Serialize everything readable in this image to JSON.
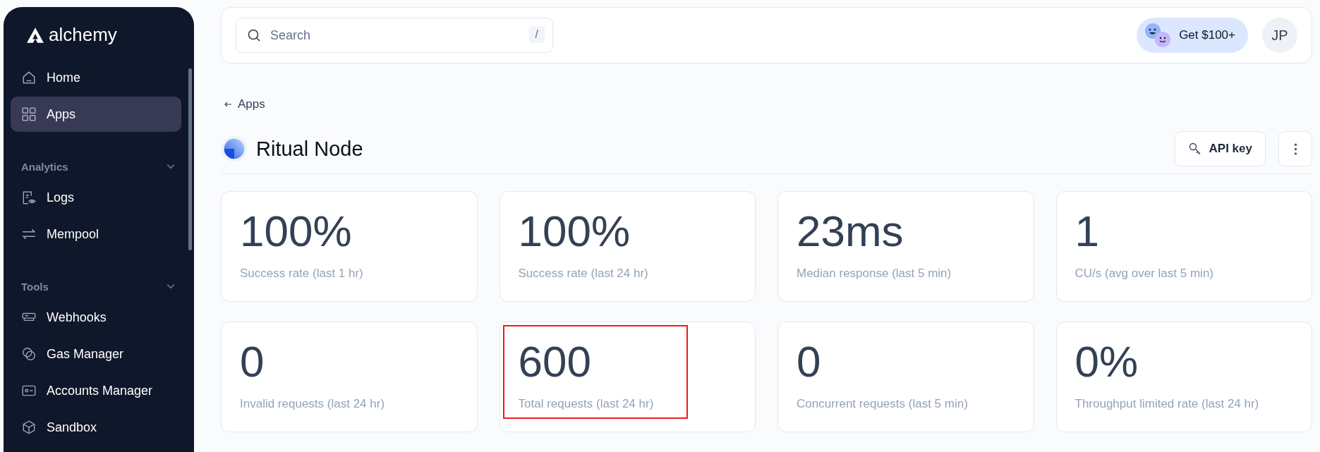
{
  "sidebar": {
    "logo": "alchemy",
    "items": [
      {
        "label": "Home",
        "selected": false
      },
      {
        "label": "Apps",
        "selected": true
      }
    ],
    "sections": [
      {
        "title": "Analytics",
        "expanded": true,
        "items": [
          {
            "label": "Logs",
            "selected": false
          },
          {
            "label": "Mempool",
            "selected": false
          }
        ]
      },
      {
        "title": "Tools",
        "expanded": true,
        "items": [
          {
            "label": "Webhooks",
            "selected": false
          },
          {
            "label": "Gas Manager",
            "selected": false
          },
          {
            "label": "Accounts Manager",
            "selected": false
          },
          {
            "label": "Sandbox",
            "selected": false
          }
        ]
      }
    ]
  },
  "header": {
    "search": {
      "placeholder": "Search",
      "shortcut": "/"
    },
    "promo": "Get $100+",
    "avatar": "JP"
  },
  "breadcrumb": "Apps",
  "app": {
    "name": "Ritual Node",
    "api_key_button": "API key"
  },
  "stats": [
    {
      "value": "100%",
      "label": "Success rate (last 1 hr)",
      "highlighted": false
    },
    {
      "value": "100%",
      "label": "Success rate (last 24 hr)",
      "highlighted": false
    },
    {
      "value": "23ms",
      "label": "Median response (last 5 min)",
      "highlighted": false
    },
    {
      "value": "1",
      "label": "CU/s (avg over last 5 min)",
      "highlighted": false
    },
    {
      "value": "0",
      "label": "Invalid requests (last 24 hr)",
      "highlighted": false
    },
    {
      "value": "600",
      "label": "Total requests (last 24 hr)",
      "highlighted": true
    },
    {
      "value": "0",
      "label": "Concurrent requests (last 5 min)",
      "highlighted": false
    },
    {
      "value": "0%",
      "label": "Throughput limited rate (last 24 hr)",
      "highlighted": false
    }
  ]
}
